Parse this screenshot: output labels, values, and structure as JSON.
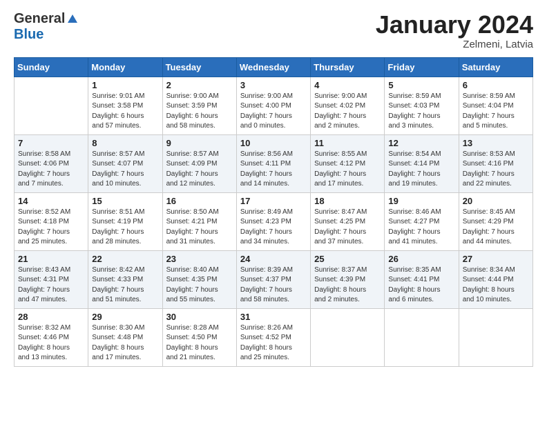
{
  "header": {
    "logo_general": "General",
    "logo_blue": "Blue",
    "month_title": "January 2024",
    "location": "Zelmeni, Latvia"
  },
  "days_of_week": [
    "Sunday",
    "Monday",
    "Tuesday",
    "Wednesday",
    "Thursday",
    "Friday",
    "Saturday"
  ],
  "weeks": [
    {
      "shaded": false,
      "days": [
        {
          "num": "",
          "info": ""
        },
        {
          "num": "1",
          "info": "Sunrise: 9:01 AM\nSunset: 3:58 PM\nDaylight: 6 hours\nand 57 minutes."
        },
        {
          "num": "2",
          "info": "Sunrise: 9:00 AM\nSunset: 3:59 PM\nDaylight: 6 hours\nand 58 minutes."
        },
        {
          "num": "3",
          "info": "Sunrise: 9:00 AM\nSunset: 4:00 PM\nDaylight: 7 hours\nand 0 minutes."
        },
        {
          "num": "4",
          "info": "Sunrise: 9:00 AM\nSunset: 4:02 PM\nDaylight: 7 hours\nand 2 minutes."
        },
        {
          "num": "5",
          "info": "Sunrise: 8:59 AM\nSunset: 4:03 PM\nDaylight: 7 hours\nand 3 minutes."
        },
        {
          "num": "6",
          "info": "Sunrise: 8:59 AM\nSunset: 4:04 PM\nDaylight: 7 hours\nand 5 minutes."
        }
      ]
    },
    {
      "shaded": true,
      "days": [
        {
          "num": "7",
          "info": "Sunrise: 8:58 AM\nSunset: 4:06 PM\nDaylight: 7 hours\nand 7 minutes."
        },
        {
          "num": "8",
          "info": "Sunrise: 8:57 AM\nSunset: 4:07 PM\nDaylight: 7 hours\nand 10 minutes."
        },
        {
          "num": "9",
          "info": "Sunrise: 8:57 AM\nSunset: 4:09 PM\nDaylight: 7 hours\nand 12 minutes."
        },
        {
          "num": "10",
          "info": "Sunrise: 8:56 AM\nSunset: 4:11 PM\nDaylight: 7 hours\nand 14 minutes."
        },
        {
          "num": "11",
          "info": "Sunrise: 8:55 AM\nSunset: 4:12 PM\nDaylight: 7 hours\nand 17 minutes."
        },
        {
          "num": "12",
          "info": "Sunrise: 8:54 AM\nSunset: 4:14 PM\nDaylight: 7 hours\nand 19 minutes."
        },
        {
          "num": "13",
          "info": "Sunrise: 8:53 AM\nSunset: 4:16 PM\nDaylight: 7 hours\nand 22 minutes."
        }
      ]
    },
    {
      "shaded": false,
      "days": [
        {
          "num": "14",
          "info": "Sunrise: 8:52 AM\nSunset: 4:18 PM\nDaylight: 7 hours\nand 25 minutes."
        },
        {
          "num": "15",
          "info": "Sunrise: 8:51 AM\nSunset: 4:19 PM\nDaylight: 7 hours\nand 28 minutes."
        },
        {
          "num": "16",
          "info": "Sunrise: 8:50 AM\nSunset: 4:21 PM\nDaylight: 7 hours\nand 31 minutes."
        },
        {
          "num": "17",
          "info": "Sunrise: 8:49 AM\nSunset: 4:23 PM\nDaylight: 7 hours\nand 34 minutes."
        },
        {
          "num": "18",
          "info": "Sunrise: 8:47 AM\nSunset: 4:25 PM\nDaylight: 7 hours\nand 37 minutes."
        },
        {
          "num": "19",
          "info": "Sunrise: 8:46 AM\nSunset: 4:27 PM\nDaylight: 7 hours\nand 41 minutes."
        },
        {
          "num": "20",
          "info": "Sunrise: 8:45 AM\nSunset: 4:29 PM\nDaylight: 7 hours\nand 44 minutes."
        }
      ]
    },
    {
      "shaded": true,
      "days": [
        {
          "num": "21",
          "info": "Sunrise: 8:43 AM\nSunset: 4:31 PM\nDaylight: 7 hours\nand 47 minutes."
        },
        {
          "num": "22",
          "info": "Sunrise: 8:42 AM\nSunset: 4:33 PM\nDaylight: 7 hours\nand 51 minutes."
        },
        {
          "num": "23",
          "info": "Sunrise: 8:40 AM\nSunset: 4:35 PM\nDaylight: 7 hours\nand 55 minutes."
        },
        {
          "num": "24",
          "info": "Sunrise: 8:39 AM\nSunset: 4:37 PM\nDaylight: 7 hours\nand 58 minutes."
        },
        {
          "num": "25",
          "info": "Sunrise: 8:37 AM\nSunset: 4:39 PM\nDaylight: 8 hours\nand 2 minutes."
        },
        {
          "num": "26",
          "info": "Sunrise: 8:35 AM\nSunset: 4:41 PM\nDaylight: 8 hours\nand 6 minutes."
        },
        {
          "num": "27",
          "info": "Sunrise: 8:34 AM\nSunset: 4:44 PM\nDaylight: 8 hours\nand 10 minutes."
        }
      ]
    },
    {
      "shaded": false,
      "days": [
        {
          "num": "28",
          "info": "Sunrise: 8:32 AM\nSunset: 4:46 PM\nDaylight: 8 hours\nand 13 minutes."
        },
        {
          "num": "29",
          "info": "Sunrise: 8:30 AM\nSunset: 4:48 PM\nDaylight: 8 hours\nand 17 minutes."
        },
        {
          "num": "30",
          "info": "Sunrise: 8:28 AM\nSunset: 4:50 PM\nDaylight: 8 hours\nand 21 minutes."
        },
        {
          "num": "31",
          "info": "Sunrise: 8:26 AM\nSunset: 4:52 PM\nDaylight: 8 hours\nand 25 minutes."
        },
        {
          "num": "",
          "info": ""
        },
        {
          "num": "",
          "info": ""
        },
        {
          "num": "",
          "info": ""
        }
      ]
    }
  ]
}
